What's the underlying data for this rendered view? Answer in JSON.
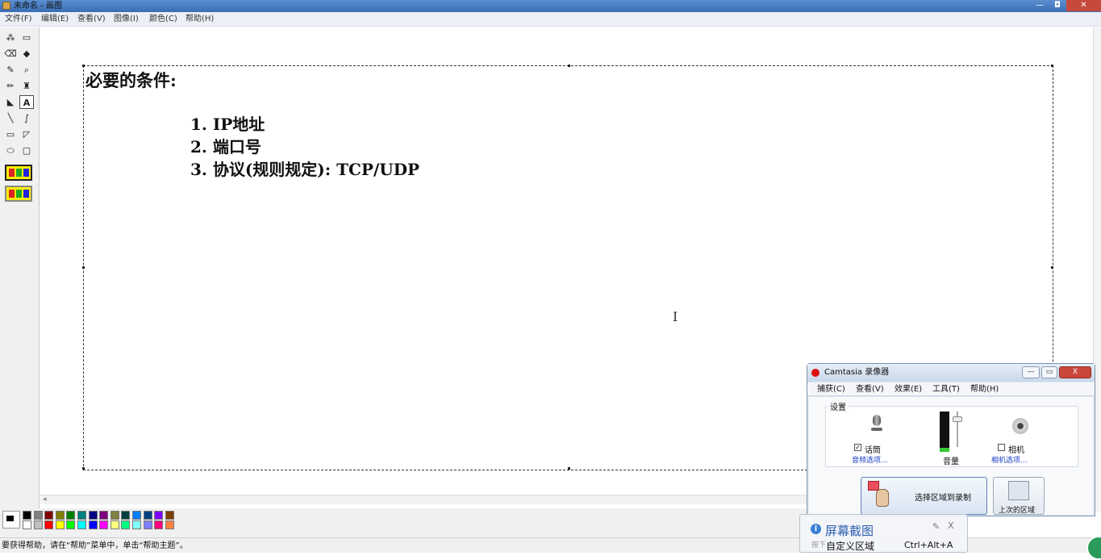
{
  "window": {
    "title": "未命名 - 画图",
    "minimize": "—",
    "maximize": "◘",
    "close": "✕"
  },
  "menu": [
    "文件(F)",
    "编辑(E)",
    "查看(V)",
    "图像(I)",
    "颜色(C)",
    "帮助(H)"
  ],
  "tools": [
    {
      "icon": "free-select-icon",
      "glyph": "⁂"
    },
    {
      "icon": "rect-select-icon",
      "glyph": "▭"
    },
    {
      "icon": "eraser-icon",
      "glyph": "⌫"
    },
    {
      "icon": "fill-icon",
      "glyph": "◆"
    },
    {
      "icon": "color-picker-icon",
      "glyph": "✎"
    },
    {
      "icon": "magnifier-icon",
      "glyph": "⌕"
    },
    {
      "icon": "pencil-icon",
      "glyph": "✏"
    },
    {
      "icon": "brush-icon",
      "glyph": "♜"
    },
    {
      "icon": "airbrush-icon",
      "glyph": "◣"
    },
    {
      "icon": "text-icon",
      "glyph": "A"
    },
    {
      "icon": "line-icon",
      "glyph": "╲"
    },
    {
      "icon": "curve-icon",
      "glyph": "∫"
    },
    {
      "icon": "rectangle-icon",
      "glyph": "▭"
    },
    {
      "icon": "polygon-icon",
      "glyph": "◸"
    },
    {
      "icon": "ellipse-icon",
      "glyph": "⬭"
    },
    {
      "icon": "rounded-rect-icon",
      "glyph": "▢"
    }
  ],
  "canvas": {
    "heading": "必要的条件:",
    "items": [
      "1. IP地址",
      "2. 端口号",
      "3. 协议(规则规定): TCP/UDP"
    ],
    "cursor_glyph": "I"
  },
  "palette": {
    "top": [
      "#000000",
      "#808080",
      "#800000",
      "#808000",
      "#008000",
      "#008080",
      "#000080",
      "#800080",
      "#808040",
      "#004040",
      "#0080ff",
      "#004080",
      "#8000ff",
      "#804000"
    ],
    "bottom": [
      "#ffffff",
      "#c0c0c0",
      "#ff0000",
      "#ffff00",
      "#00ff00",
      "#00ffff",
      "#0000ff",
      "#ff00ff",
      "#ffff80",
      "#00ff80",
      "#80ffff",
      "#8080ff",
      "#ff0080",
      "#ff8040"
    ]
  },
  "status": "要获得帮助，请在“帮助”菜单中，单击“帮助主题”。",
  "camtasia": {
    "title": "Camtasia 录像器",
    "menu": [
      "捕获(C)",
      "查看(V)",
      "效果(E)",
      "工具(T)",
      "帮助(H)"
    ],
    "settings_label": "设置",
    "mic_label": "话筒",
    "mic_checked": true,
    "mic_options": "音频选项...",
    "volume_label": "音量",
    "volume_level": 0.1,
    "camera_label": "相机",
    "camera_checked": false,
    "camera_options": "相机选项...",
    "record_button": "选择区域到录制",
    "last_button": "上次的区域",
    "min": "—",
    "max": "▭",
    "close": "X"
  },
  "snip": {
    "title": "屏幕截图",
    "hint": "按下",
    "mode": "自定义区域",
    "shortcut": "Ctrl+Alt+A",
    "pin": "✎",
    "close": "X"
  }
}
